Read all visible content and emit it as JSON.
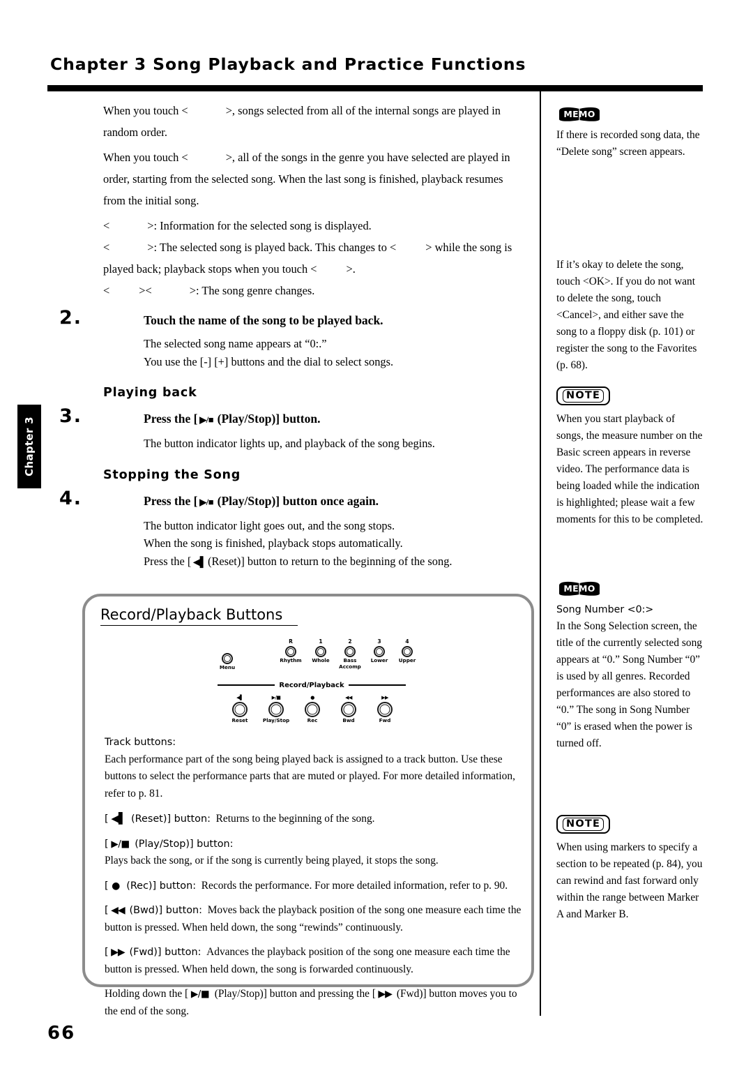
{
  "header": {
    "chapter_title": "Chapter 3 Song Playback and Practice Functions"
  },
  "margin": {
    "chapter_tab": "Chapter 3",
    "page_number": "66"
  },
  "main": {
    "intro_paragraphs": [
      {
        "before": "When you touch <",
        "after": ">, songs selected from all of the internal songs are played in random order."
      },
      {
        "before": "When you touch <",
        "after": ">, all of the songs in the genre you have selected are played in order, starting from the selected song. When the last song is finished, playback resumes from the initial song."
      }
    ],
    "bullet_lines": [
      {
        "before": "<",
        "after": ">: Information for the selected song is displayed."
      },
      {
        "before": "<",
        "mid": ">: The selected song is played back. This changes to <",
        "after": "> while the song is played back; playback stops when you touch <",
        "tail": ">."
      },
      {
        "before": "<",
        "mid": "><",
        "after": ">: The song genre changes."
      }
    ],
    "step2": {
      "number": "2.",
      "title": "Touch the name of the song to be played back.",
      "body_line1": "The selected song name appears at “0:.”",
      "body_line2": "You use the [-] [+] buttons and the dial to select songs."
    },
    "heading_playing_back": "Playing back",
    "step3": {
      "number": "3.",
      "title_pre": "Press the [",
      "title_post": "(Play/Stop)] button.",
      "body": "The button indicator lights up, and playback of the song begins."
    },
    "heading_stopping": "Stopping the Song",
    "step4": {
      "number": "4.",
      "title_pre": "Press the [",
      "title_post": "(Play/Stop)] button once again.",
      "body_line1": "The button indicator light goes out, and the song stops.",
      "body_line2": "When the song is finished, playback stops automatically.",
      "body_line3_pre": "Press the [",
      "body_line3_post": "(Reset)] button to return to the beginning of the song."
    }
  },
  "record_box": {
    "title": "Record/Playback Buttons",
    "panel": {
      "upper_knobs": [
        {
          "num": "",
          "label": "Menu"
        },
        {
          "num": "R",
          "label": "Rhythm"
        },
        {
          "num": "1",
          "label": "Whole"
        },
        {
          "num": "2",
          "label": "Bass\nAccomp"
        },
        {
          "num": "3",
          "label": "Lower"
        },
        {
          "num": "4",
          "label": "Upper"
        }
      ],
      "banner_label": "Record/Playback",
      "transport_buttons": [
        {
          "symbol": "◀▌",
          "label": "Reset"
        },
        {
          "symbol": "▶/■",
          "label": "Play/Stop"
        },
        {
          "symbol": "●",
          "label": "Rec"
        },
        {
          "symbol": "◀◀",
          "label": "Bwd"
        },
        {
          "symbol": "▶▶",
          "label": "Fwd"
        }
      ]
    },
    "track_buttons_label": "Track buttons:",
    "track_buttons_desc": "Each performance part of the song being played back is assigned to a track button. Use these buttons to select the performance parts that are muted or played. For more detailed information, refer to p. 81.",
    "entries": [
      {
        "pre": "[",
        "symbol": "◀▌",
        "post": "(Reset)] button:",
        "desc": "Returns to the beginning of the song.",
        "inline": true
      },
      {
        "pre": "[",
        "symbol": "▶/■",
        "post": "(Play/Stop)] button:",
        "desc": "Plays back the song, or if the song is currently being played, it stops the song.",
        "inline": false
      },
      {
        "pre": "[",
        "symbol": "●",
        "post": "(Rec)] button:",
        "desc": "Records the performance. For more detailed information, refer to p. 90.",
        "inline": true
      },
      {
        "pre": "[",
        "symbol": "◀◀",
        "post": "(Bwd)] button:",
        "desc": "Moves back the playback position of the song one measure each time the button is pressed. When held down, the song “rewinds” continuously.",
        "inline": true
      },
      {
        "pre": "[",
        "symbol": "▶▶",
        "post": "(Fwd)] button:",
        "desc": "Advances the playback position of the song one measure each time the button is pressed. When held down, the song is forwarded continuously.",
        "inline": true
      }
    ],
    "final_note": {
      "part1": "Holding down the [",
      "sym1": "▶/■",
      "part2": "(Play/Stop)] button and pressing the [",
      "sym2": "▶▶",
      "part3": "(Fwd)] button moves you to the end of the song."
    }
  },
  "sidebar": {
    "blocks": [
      {
        "badge": "MEMO",
        "badge_type": "memo",
        "text": "If there is recorded song data, the “Delete song” screen appears."
      },
      {
        "badge": "",
        "badge_type": "none",
        "text": "If it’s okay to delete the song, touch <OK>. If you do not want to delete the song, touch <Cancel>, and either save the song to a floppy disk (p. 101) or register the song to the Favorites (p. 68)."
      },
      {
        "badge": "NOTE",
        "badge_type": "note",
        "text": "When you start playback of songs, the measure number on the Basic screen appears in reverse video. The performance data is being loaded while the indication is highlighted; please wait a few moments for this to be completed."
      },
      {
        "badge": "MEMO",
        "badge_type": "memo",
        "subtitle": "Song Number <0:>",
        "text": "In the Song Selection screen, the title of the currently selected song appears at “0.” Song Number “0” is used by all genres. Recorded performances are also stored to “0.” The song in Song Number “0” is erased when the power is turned off."
      },
      {
        "badge": "NOTE",
        "badge_type": "note",
        "text": "When using markers to specify a section to be repeated (p. 84), you can rewind and fast forward only within the range between Marker A and Marker B."
      }
    ]
  },
  "colors": {
    "ink": "#000000",
    "box_border": "#8c8c8c",
    "paper": "#ffffff"
  }
}
